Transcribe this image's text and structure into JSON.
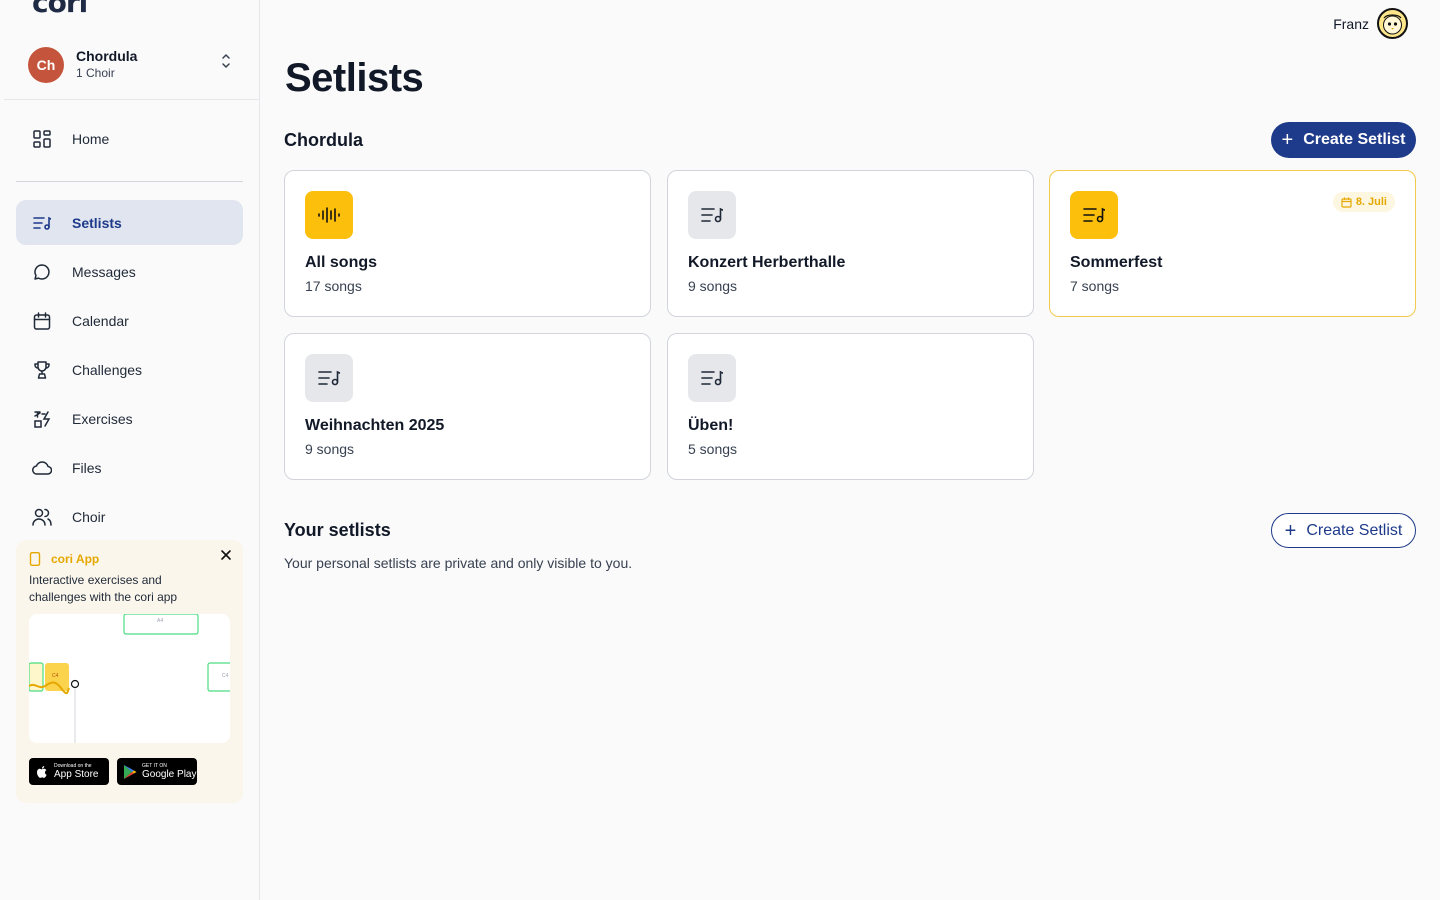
{
  "app": {
    "logo": "cori"
  },
  "choir_switcher": {
    "initials": "Ch",
    "name": "Chordula",
    "count": "1 Choir"
  },
  "nav": {
    "home": "Home",
    "items": [
      {
        "label": "Setlists",
        "icon": "setlist-icon",
        "active": true
      },
      {
        "label": "Messages",
        "icon": "message-icon"
      },
      {
        "label": "Calendar",
        "icon": "calendar-icon"
      },
      {
        "label": "Challenges",
        "icon": "trophy-icon"
      },
      {
        "label": "Exercises",
        "icon": "exercise-icon"
      },
      {
        "label": "Files",
        "icon": "cloud-icon"
      },
      {
        "label": "Choir",
        "icon": "users-icon"
      }
    ]
  },
  "promo": {
    "title": "cori App",
    "description": "Interactive exercises and challenges with the cori app",
    "preview_notes": [
      "A4",
      "C4",
      "C4"
    ],
    "app_store": {
      "small": "Download on the",
      "big": "App Store"
    },
    "google_play": {
      "small": "GET IT ON",
      "big": "Google Play"
    }
  },
  "user": {
    "name": "Franz"
  },
  "page": {
    "title": "Setlists"
  },
  "choir_section": {
    "title": "Chordula",
    "create_label": "Create Setlist",
    "cards": [
      {
        "name": "All songs",
        "count": "17 songs",
        "icon": "audio-wave-icon",
        "accent": "#fbbf0c"
      },
      {
        "name": "Konzert Herberthalle",
        "count": "9 songs",
        "icon": "setlist-icon"
      },
      {
        "name": "Sommerfest",
        "count": "7 songs",
        "icon": "setlist-icon",
        "accent": "#fbbf0c",
        "date": "8. Juli"
      },
      {
        "name": "Weihnachten 2025",
        "count": "9 songs",
        "icon": "setlist-icon"
      },
      {
        "name": "Üben!",
        "count": "5 songs",
        "icon": "setlist-icon"
      }
    ]
  },
  "personal_section": {
    "title": "Your setlists",
    "create_label": "Create Setlist",
    "description": "Your personal setlists are private and only visible to you."
  },
  "colors": {
    "primary": "#1e3a8a",
    "accent": "#fbbf0c",
    "choir_avatar": "#c4553c"
  }
}
